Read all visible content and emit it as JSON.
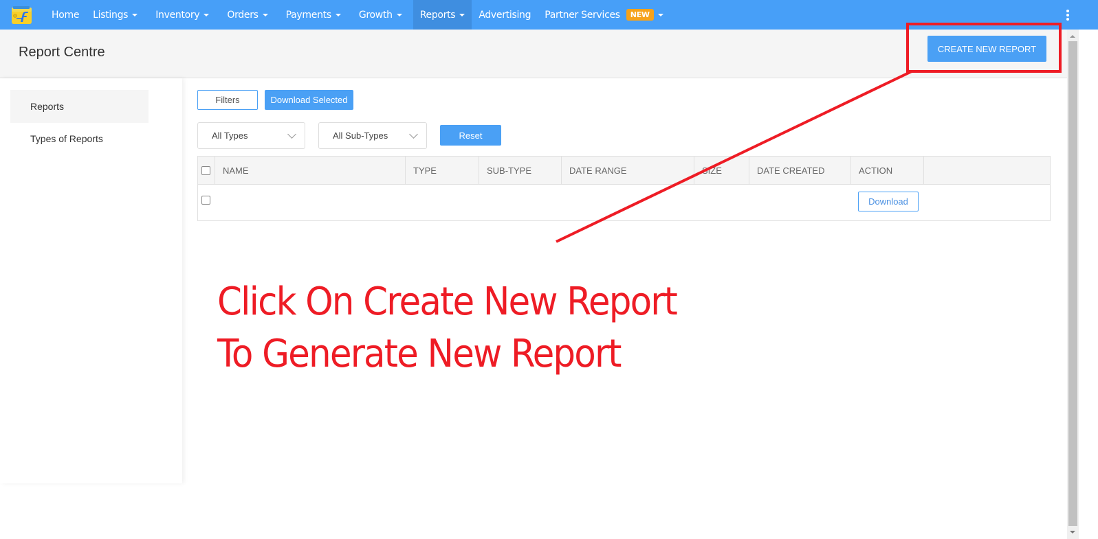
{
  "topnav": {
    "logo_icon": "flipkart-wallet-logo",
    "items": [
      {
        "label": "Home",
        "dropdown": false
      },
      {
        "label": "Listings",
        "dropdown": true
      },
      {
        "label": "Inventory",
        "dropdown": true
      },
      {
        "label": "Orders",
        "dropdown": true
      },
      {
        "label": "Payments",
        "dropdown": true
      },
      {
        "label": "Growth",
        "dropdown": true
      },
      {
        "label": "Reports",
        "dropdown": true,
        "active": true
      },
      {
        "label": "Advertising",
        "dropdown": false
      },
      {
        "label": "Partner Services",
        "dropdown": true,
        "badge": "NEW"
      }
    ],
    "more_icon": "kebab-menu-icon",
    "colors": {
      "bar": "#479ff8",
      "active": "#3f8ee0",
      "badge": "#f6a21a"
    }
  },
  "header": {
    "title": "Report Centre",
    "create_button": "CREATE NEW REPORT"
  },
  "sidebar": {
    "items": [
      {
        "label": "Reports",
        "active": true
      },
      {
        "label": "Types of Reports",
        "active": false
      }
    ]
  },
  "toolbar": {
    "filters_label": "Filters",
    "download_selected_label": "Download Selected",
    "type_select": "All Types",
    "subtype_select": "All Sub-Types",
    "reset_label": "Reset"
  },
  "table": {
    "columns": [
      "NAME",
      "TYPE",
      "SUB-TYPE",
      "DATE RANGE",
      "SIZE",
      "DATE CREATED",
      "ACTION"
    ],
    "rows": [
      {
        "name": "",
        "type": "",
        "sub_type": "",
        "date_range": "",
        "size": "",
        "date_created": "",
        "action": "Download"
      }
    ]
  },
  "annotation": {
    "line1": "Click On Create New Report",
    "line2": "To Generate New Report",
    "color": "#ee1c25"
  },
  "accent_color": "#4aa0f5"
}
